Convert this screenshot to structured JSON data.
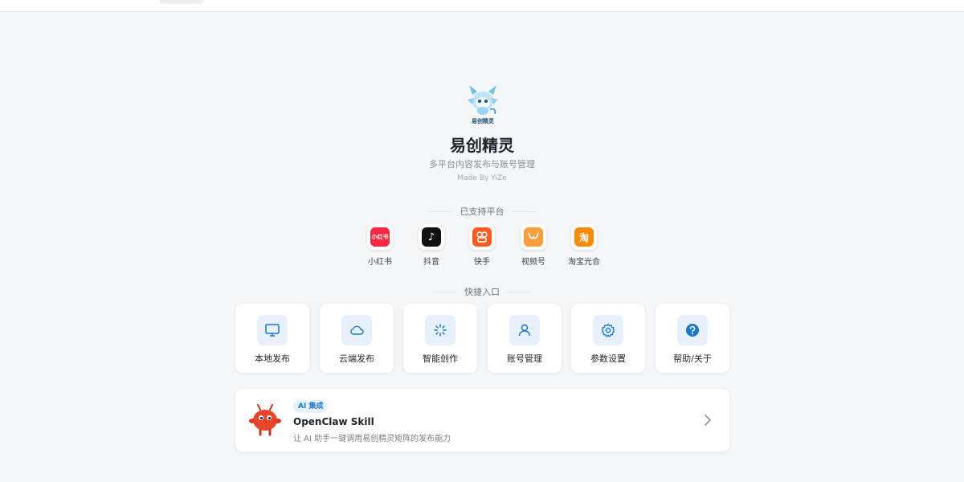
{
  "app": {
    "title": "易创精灵",
    "subtitle": "多平台内容发布与账号管理",
    "made_by": "Made By YiZe",
    "logo_caption": "易创精灵"
  },
  "platforms_section": {
    "label": "已支持平台",
    "items": [
      {
        "label": "小红书",
        "icon": "xiaohongshu-icon",
        "icon_text": "小红书",
        "color": "#ff2741"
      },
      {
        "label": "抖音",
        "icon": "douyin-icon",
        "icon_text": "♪",
        "color": "#111111"
      },
      {
        "label": "快手",
        "icon": "kuaishou-icon",
        "icon_text": "",
        "color": "#ff5a1f"
      },
      {
        "label": "视频号",
        "icon": "shipinhao-icon",
        "icon_text": "",
        "color": "#fa9d3b"
      },
      {
        "label": "淘宝光合",
        "icon": "taobao-icon",
        "icon_text": "淘",
        "color": "#ff8a00"
      }
    ]
  },
  "quick_section": {
    "label": "快捷入口",
    "items": [
      {
        "label": "本地发布",
        "icon": "monitor-icon"
      },
      {
        "label": "云端发布",
        "icon": "cloud-icon"
      },
      {
        "label": "智能创作",
        "icon": "sparkle-loader-icon"
      },
      {
        "label": "账号管理",
        "icon": "user-icon"
      },
      {
        "label": "参数设置",
        "icon": "gear-icon"
      },
      {
        "label": "帮助/关于",
        "icon": "help-icon"
      }
    ]
  },
  "banner": {
    "badge": "AI 集成",
    "title": "OpenClaw Skill",
    "description": "让 AI 助手一键调用易创精灵矩阵的发布能力",
    "icon": "chevron-right-icon"
  },
  "colors": {
    "accent": "#1677d2",
    "icon_bg": "#e6f1fd",
    "background": "#f5f6f8"
  }
}
